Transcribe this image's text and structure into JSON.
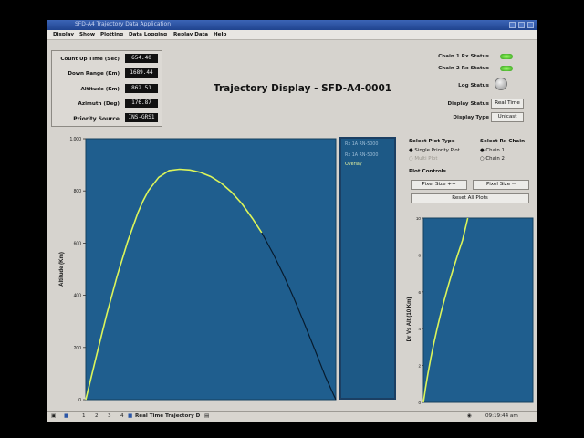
{
  "window": {
    "title": "SFD-A4 Trajectory Data Application"
  },
  "menu": [
    "Display",
    "Show",
    "Plotting",
    "Data Logging",
    "Replay Data",
    "Help"
  ],
  "status_fields": [
    {
      "label": "Count Up Time (Sec)",
      "value": "654.40"
    },
    {
      "label": "Down Range (Km)",
      "value": "1689.44"
    },
    {
      "label": "Altitude (Km)",
      "value": "862.51"
    },
    {
      "label": "Azimuth (Deg)",
      "value": "176.87"
    },
    {
      "label": "Priority Source",
      "value": "INS-GRS1"
    }
  ],
  "page_title": "Trajectory Display -  SFD-A4-0001",
  "right_status": {
    "chain1_label": "Chain 1 Rx Status",
    "chain2_label": "Chain 2 Rx Status",
    "log_label": "Log Status",
    "display_status_label": "Display Status",
    "display_status_value": "Real Time",
    "display_type_label": "Display Type",
    "display_type_value": "Unicast",
    "led_color": "#6fe23a"
  },
  "plot_type": {
    "heading": "Select Plot Type",
    "options": [
      "Single Priority Plot",
      "Multi Plot"
    ],
    "selected": 0
  },
  "rx_chain": {
    "heading": "Select Rx Chain",
    "options": [
      "Chain 1",
      "Chain 2"
    ],
    "selected": 0
  },
  "plot_controls": {
    "heading": "Plot Controls",
    "size_plus": "Pixel Size ++",
    "size_minus": "Pixel Size --",
    "reset": "Reset All Plots"
  },
  "legend": [
    "Rx 1A RN-5000",
    "Rx 1A RN-5000",
    "Overlay"
  ],
  "chart_data": [
    {
      "type": "line",
      "title": "",
      "xlabel": "",
      "ylabel": "Altitude (Km)",
      "ylim": [
        0,
        1000
      ],
      "yticks": [
        "0",
        "200",
        "400",
        "600",
        "800",
        "1,000"
      ],
      "series": [
        {
          "x": [
            0,
            100,
            200,
            300,
            400,
            500,
            550,
            600,
            700,
            800,
            900,
            1000,
            1100,
            1200,
            1300,
            1400,
            1500,
            1600,
            1689,
            1800,
            1900,
            2000,
            2100,
            2200,
            2300,
            2400,
            2500,
            2600,
            2700,
            2800,
            2900,
            3000
          ],
          "y": [
            0,
            164,
            325,
            473,
            604,
            716,
            762,
            800,
            852,
            878,
            883,
            880,
            871,
            855,
            830,
            795,
            750,
            694,
            640,
            558,
            477,
            387,
            289,
            190,
            88,
            0,
            0,
            0,
            0,
            0,
            0,
            0
          ]
        }
      ],
      "bright_series_end_x": 1689,
      "xlim": [
        0,
        2400
      ],
      "grid": false
    },
    {
      "type": "line",
      "title": "",
      "xlabel": "",
      "ylabel": "Dr Vs Alt (10 Km)",
      "ylim": [
        0,
        10
      ],
      "yticks": [
        "0",
        "2",
        "4",
        "6",
        "8",
        "10"
      ],
      "series": [
        {
          "x": [
            0,
            0.8,
            1.7,
            2.7,
            3.8,
            5.0,
            6.3,
            7.7,
            9.2,
            10.8,
            12.5,
            14.3,
            16.2
          ],
          "y": [
            0,
            0.8,
            1.6,
            2.4,
            3.2,
            4.0,
            4.8,
            5.6,
            6.4,
            7.2,
            8.0,
            8.8,
            10
          ]
        }
      ],
      "xlim": [
        0,
        40
      ],
      "grid": false
    }
  ],
  "taskbar": {
    "items": [
      "1",
      "2",
      "3",
      "4"
    ],
    "app": "Real Time Trajectory D",
    "clock": "09:19:44 am"
  }
}
